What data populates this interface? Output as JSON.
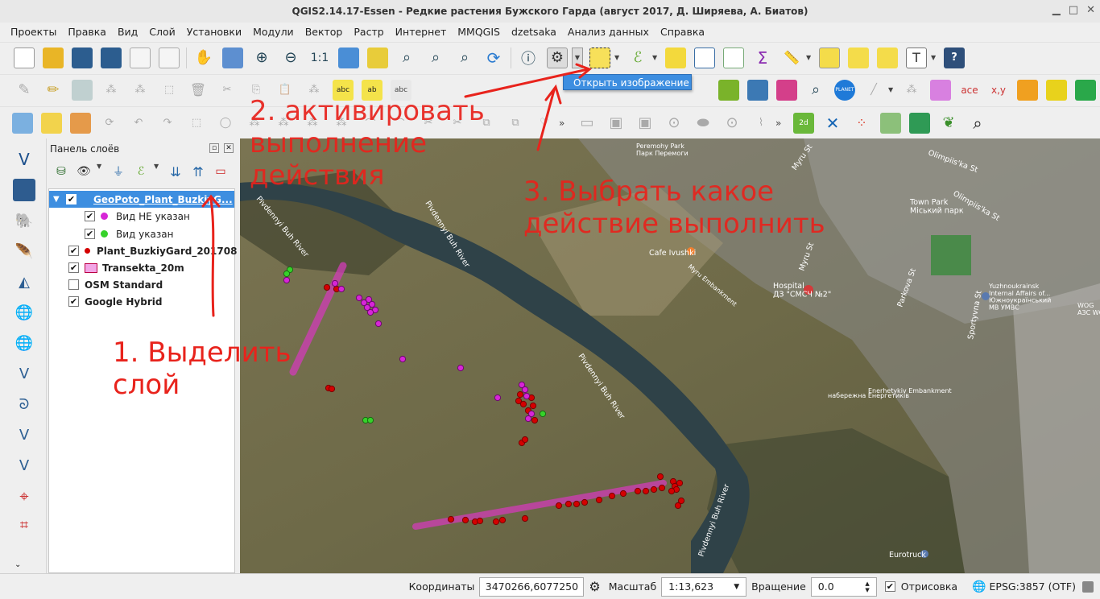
{
  "window": {
    "title": "QGIS2.14.17-Essen - Редкие растения Бужского Гарда (август 2017, Д. Ширяева, А. Биатов)"
  },
  "menu": [
    "Проекты",
    "Правка",
    "Вид",
    "Слой",
    "Установки",
    "Модули",
    "Вектор",
    "Растр",
    "Интернет",
    "MMQGIS",
    "dzetsaka",
    "Анализ данных",
    "Справка"
  ],
  "action_popup": {
    "label": "Открыть изображение"
  },
  "layers_panel": {
    "title": "Панель слоёв",
    "layers": [
      {
        "name": "GeoPoto_Plant_BuzkiyG...",
        "checked": true,
        "selected": true,
        "expanded": true
      },
      {
        "name": "Вид НЕ указан",
        "checked": true,
        "symbol_color": "#d726d7"
      },
      {
        "name": "Вид указан",
        "checked": true,
        "symbol_color": "#36d22a"
      },
      {
        "name": "Plant_BuzkiyGard_201708",
        "checked": true,
        "symbol_color": "#d40000"
      },
      {
        "name": "Transekta_20m",
        "checked": true,
        "symbol_color": "#f2a6e6"
      },
      {
        "name": "OSM Standard",
        "checked": false
      },
      {
        "name": "Google Hybrid",
        "checked": true
      }
    ]
  },
  "map_labels": {
    "river1": "Pivdennyi Buh River",
    "river2": "Pivdennyi Buh River",
    "river3": "Pivdennyi Buh River",
    "street_myru1": "Myru St",
    "street_myru2": "Myru St",
    "street_olimp1": "Olimpiis'ka St",
    "street_olimp2": "Olimpiis'ka St",
    "park_peremogy": "Peremohy Park\nПарк Перемоги",
    "town_park": "Town Park\nМіський парк",
    "cafe": "Cafe Ivushki",
    "hospital": "Hospital\nДЗ \"СМСЧ №2\"",
    "energetykiv": "Enerhetykiv Embankment",
    "energetykiv2": "набережна Енергетиків",
    "yuzhno": "Yuzhnoukrainsk\nInternal Affairs of...\nЮжноукраїнський\nМВ УМВС",
    "parkova": "Parkova St",
    "sportyvna": "Sportyvna St",
    "eurotruck": "Eurotruck",
    "myru_emb": "Myru Embankment",
    "woge": "WOG\nАЗС WOG"
  },
  "annotations": {
    "step1": "1. Выделить\nслой",
    "step2": "2. активировать\nвыполнение\nдействия",
    "step3": "3. Выбрать какое\nдействие выполнить"
  },
  "statusbar": {
    "coords_label": "Координаты",
    "coords_value": "3470266,6077250",
    "scale_label": "Масштаб",
    "scale_value": "1:13,623",
    "rotation_label": "Вращение",
    "rotation_value": "0.0",
    "render_label": "Отрисовка",
    "render_checked": true,
    "crs": "EPSG:3857 (OTF)"
  },
  "colors": {
    "accent": "#3d8ee0",
    "annotation": "#e8231c",
    "transect": "#d23cb8"
  }
}
